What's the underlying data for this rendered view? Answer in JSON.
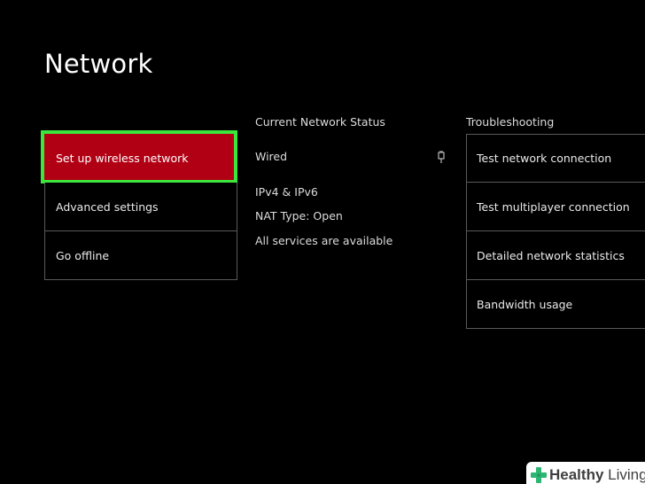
{
  "page": {
    "title": "Network"
  },
  "left_menu": {
    "items": [
      {
        "label": "Set up wireless network",
        "selected": true
      },
      {
        "label": "Advanced settings",
        "selected": false
      },
      {
        "label": "Go offline",
        "selected": false
      }
    ]
  },
  "status": {
    "heading": "Current Network Status",
    "connection": "Wired",
    "connection_icon": "ethernet-plug-icon",
    "lines": [
      "IPv4 & IPv6",
      "NAT Type: Open",
      "All services are available"
    ]
  },
  "troubleshooting": {
    "heading": "Troubleshooting",
    "items": [
      {
        "label": "Test network connection"
      },
      {
        "label": "Test multiplayer connection"
      },
      {
        "label": "Detailed network statistics"
      },
      {
        "label": "Bandwidth usage"
      }
    ]
  },
  "watermark": {
    "brand_bold": "Healthy",
    "brand_light": " Living",
    "icon": "green-cross-icon"
  },
  "colors": {
    "background": "#000000",
    "selected_fill": "#b10014",
    "focus_ring": "#3ce63c",
    "divider": "#5a5a5a",
    "watermark_cross": "#2bb673"
  }
}
